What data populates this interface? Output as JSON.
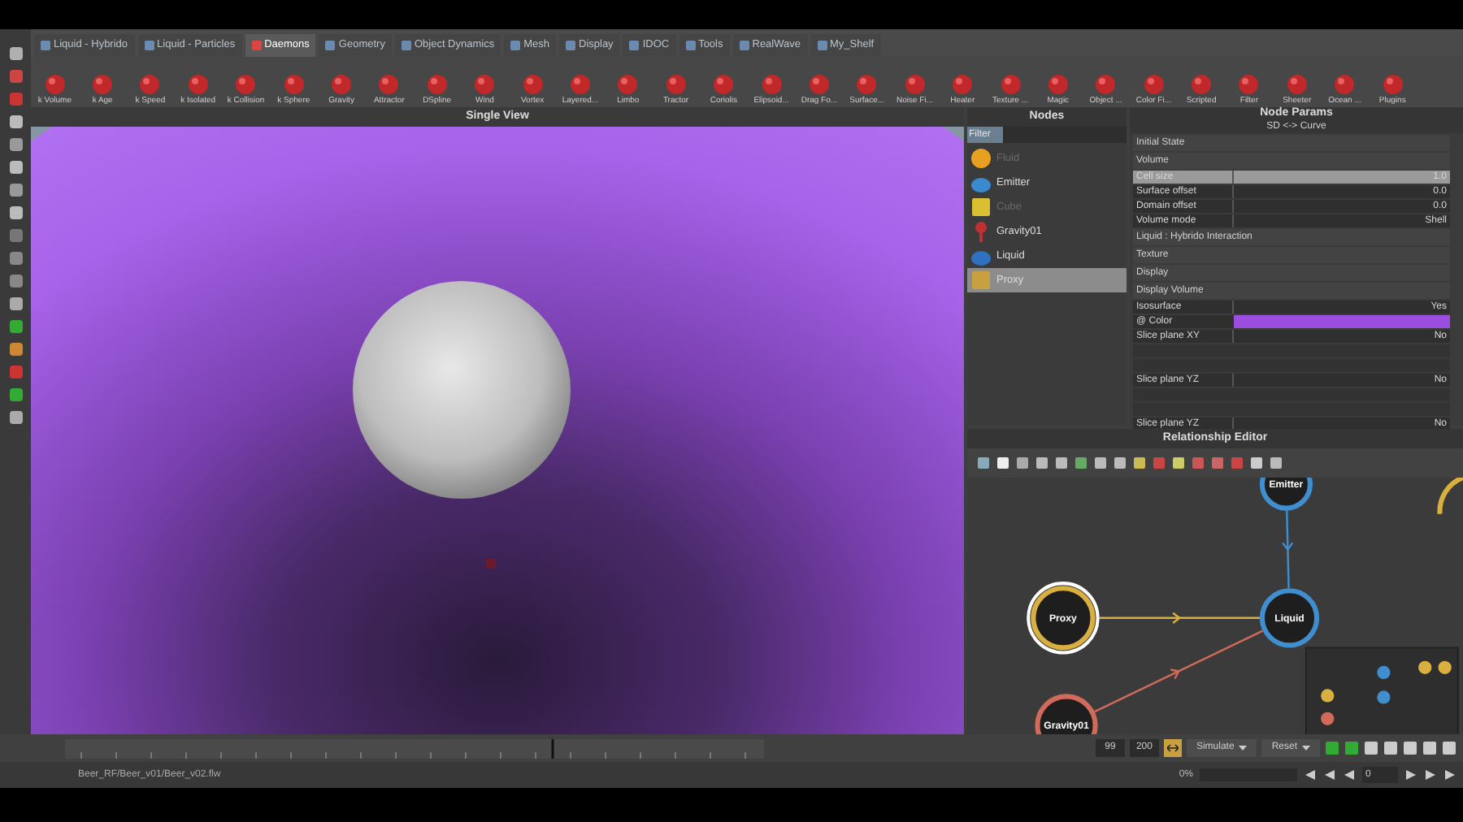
{
  "tabs": [
    {
      "label": "Liquid - Hybrido",
      "selected": false
    },
    {
      "label": "Liquid - Particles",
      "selected": false
    },
    {
      "label": "Daemons",
      "selected": true
    },
    {
      "label": "Geometry",
      "selected": false
    },
    {
      "label": "Object Dynamics",
      "selected": false
    },
    {
      "label": "Mesh",
      "selected": false
    },
    {
      "label": "Display",
      "selected": false
    },
    {
      "label": "IDOC",
      "selected": false
    },
    {
      "label": "Tools",
      "selected": false
    },
    {
      "label": "RealWave",
      "selected": false
    },
    {
      "label": "My_Shelf",
      "selected": false
    }
  ],
  "shelf": [
    "k Volume",
    "k Age",
    "k Speed",
    "k Isolated",
    "k Collision",
    "k Sphere",
    "Gravity",
    "Attractor",
    "DSpline",
    "Wind",
    "Vortex",
    "Layered...",
    "Limbo",
    "Tractor",
    "Coriolis",
    "Elipsoid...",
    "Drag Fo...",
    "Surface...",
    "Noise Fi...",
    "Heater",
    "Texture ...",
    "Magic",
    "Object ...",
    "Color Fi...",
    "Scripted",
    "Filter",
    "Sheeter",
    "Ocean ...",
    "Plugins"
  ],
  "viewport": {
    "title": "Single View"
  },
  "nodes_panel": {
    "title": "Nodes",
    "filter": "Filter",
    "items": [
      {
        "label": "Fluid",
        "kind": "sphere",
        "selected": false,
        "disabled": true
      },
      {
        "label": "Emitter",
        "kind": "emitter",
        "selected": false,
        "disabled": false
      },
      {
        "label": "Cube",
        "kind": "cube",
        "selected": false,
        "disabled": true
      },
      {
        "label": "Gravity01",
        "kind": "gravity",
        "selected": false,
        "disabled": false
      },
      {
        "label": "Liquid",
        "kind": "liquid",
        "selected": false,
        "disabled": false
      },
      {
        "label": "Proxy",
        "kind": "proxy",
        "selected": true,
        "disabled": false
      }
    ]
  },
  "params": {
    "title": "Node Params",
    "subtitle": "SD <-> Curve",
    "rows": [
      {
        "kind": "section",
        "label": "Initial State"
      },
      {
        "kind": "section",
        "label": "Volume"
      },
      {
        "kind": "param",
        "label": "Cell size",
        "value": "1.0",
        "selected": true,
        "disabled": false
      },
      {
        "kind": "param",
        "label": "Surface offset",
        "value": "0.0",
        "selected": false,
        "disabled": false
      },
      {
        "kind": "param",
        "label": "Domain offset",
        "value": "0.0",
        "selected": false,
        "disabled": false
      },
      {
        "kind": "param",
        "label": "Volume mode",
        "value": "Shell",
        "selected": false,
        "disabled": false
      },
      {
        "kind": "section",
        "label": "Liquid : Hybrido Interaction"
      },
      {
        "kind": "section",
        "label": "Texture"
      },
      {
        "kind": "section",
        "label": "Display"
      },
      {
        "kind": "section",
        "label": "Display Volume"
      },
      {
        "kind": "param",
        "label": "Isosurface",
        "value": "Yes",
        "selected": false,
        "disabled": false
      },
      {
        "kind": "color",
        "label": "@ Color",
        "color": "#9b4de0"
      },
      {
        "kind": "param",
        "label": "Slice plane XY",
        "value": "No",
        "selected": false,
        "disabled": false
      },
      {
        "kind": "blank"
      },
      {
        "kind": "blank"
      },
      {
        "kind": "param",
        "label": "Slice plane YZ",
        "value": "No",
        "selected": false,
        "disabled": false
      },
      {
        "kind": "blank"
      },
      {
        "kind": "blank"
      },
      {
        "kind": "param",
        "label": "Slice plane YZ",
        "value": "No",
        "selected": false,
        "disabled": false
      }
    ]
  },
  "relationship_editor": {
    "title": "Relationship Editor",
    "nodes": [
      {
        "label": "Emitter",
        "color": "#3f8fd0",
        "selected": false
      },
      {
        "label": "Proxy",
        "color": "#d9b040",
        "selected": true
      },
      {
        "label": "Liquid",
        "color": "#3f8fd0",
        "selected": false
      },
      {
        "label": "Gravity01",
        "color": "#d06a5a",
        "selected": false
      }
    ]
  },
  "timeline": {
    "start": "99",
    "end": "200",
    "simulate": "Simulate",
    "reset": "Reset"
  },
  "status_bar": {
    "path": "Beer_RF/Beer_v01/Beer_v02.flw",
    "progress": "0%",
    "level": 0,
    "frame": "0"
  }
}
